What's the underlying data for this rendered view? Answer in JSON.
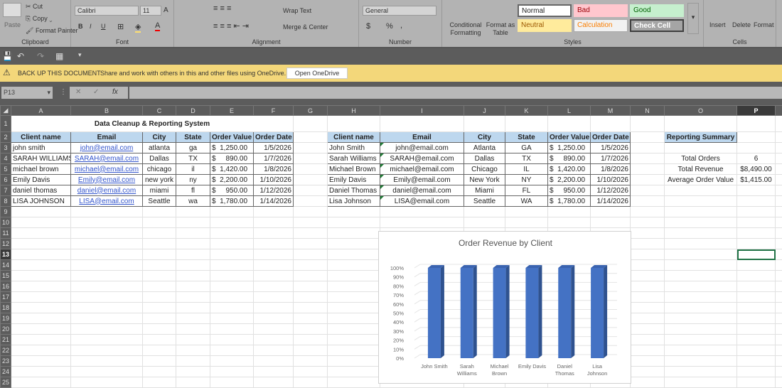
{
  "ribbon": {
    "clipboard": {
      "paste": "Paste",
      "cut": "Cut",
      "copy": "Copy",
      "format_painter": "Format Painter",
      "label": "Clipboard"
    },
    "font": {
      "name": "Calibri",
      "size": "11",
      "bold": "B",
      "italic": "I",
      "underline": "U",
      "label": "Font"
    },
    "alignment": {
      "wrap_text": "Wrap Text",
      "merge_center": "Merge & Center",
      "label": "Alignment"
    },
    "number": {
      "format": "General",
      "currency": "$",
      "percent": "%",
      "comma": ",",
      "label": "Number"
    },
    "styles": {
      "conditional_formatting": "Conditional Formatting",
      "format_as_table": "Format as Table",
      "normal": "Normal",
      "bad": "Bad",
      "good": "Good",
      "neutral": "Neutral",
      "calculation": "Calculation",
      "check_cell": "Check Cell",
      "label": "Styles"
    },
    "cells": {
      "insert": "Insert",
      "delete": "Delete",
      "format": "Format",
      "label": "Cells"
    }
  },
  "message_bar": {
    "title": "BACK UP THIS DOCUMENT",
    "text": "Share and work with others in this and other files using OneDrive.",
    "button": "Open OneDrive"
  },
  "formula_bar": {
    "name_box": "P13",
    "fx": "fx",
    "value": ""
  },
  "columns": [
    "A",
    "B",
    "C",
    "D",
    "E",
    "F",
    "G",
    "H",
    "I",
    "J",
    "K",
    "L",
    "M",
    "N",
    "O",
    "P",
    ""
  ],
  "selected_cell": "P13",
  "title": "Data Cleanup & Reporting System",
  "raw_table": {
    "headers": [
      "Client name",
      "Email",
      "City",
      "State",
      "Order Value",
      "Order Date"
    ],
    "rows": [
      [
        "john smith",
        "john@email.com",
        "atlanta",
        "ga",
        "$  1,250.00",
        "1/5/2026"
      ],
      [
        "SARAH WILLIAMS",
        "SARAH@email.com",
        "Dallas",
        "TX",
        "$     890.00",
        "1/7/2026"
      ],
      [
        "michael brown",
        "michael@email.com",
        "chicago",
        "il",
        "$  1,420.00",
        "1/8/2026"
      ],
      [
        "Emily Davis",
        "Emily@email.com",
        "new york",
        "ny",
        "$  2,200.00",
        "1/10/2026"
      ],
      [
        "daniel thomas",
        "daniel@email.com",
        "miami",
        "fl",
        "$     950.00",
        "1/12/2026"
      ],
      [
        "LISA JOHNSON",
        "LISA@email.com",
        "Seattle",
        "wa",
        "$  1,780.00",
        "1/14/2026"
      ]
    ]
  },
  "clean_table": {
    "headers": [
      "Client name",
      "Email",
      "City",
      "State",
      "Order Value",
      "Order Date"
    ],
    "rows": [
      [
        "John Smith",
        "john@email.com",
        "Atlanta",
        "GA",
        "$  1,250.00",
        "1/5/2026"
      ],
      [
        "Sarah Williams",
        "SARAH@email.com",
        "Dallas",
        "TX",
        "$     890.00",
        "1/7/2026"
      ],
      [
        "Michael Brown",
        "michael@email.com",
        "Chicago",
        "IL",
        "$  1,420.00",
        "1/8/2026"
      ],
      [
        "Emily Davis",
        "Emily@email.com",
        "New York",
        "NY",
        "$  2,200.00",
        "1/10/2026"
      ],
      [
        "Daniel Thomas",
        "daniel@email.com",
        "Miami",
        "FL",
        "$     950.00",
        "1/12/2026"
      ],
      [
        "Lisa Johnson",
        "LISA@email.com",
        "Seattle",
        "WA",
        "$  1,780.00",
        "1/14/2026"
      ]
    ]
  },
  "summary": {
    "header": "Reporting Summary",
    "items": [
      {
        "label": "Total Orders",
        "value": "6"
      },
      {
        "label": "Total Revenue",
        "value": "$8,490.00"
      },
      {
        "label": "Average Order Value",
        "value": "$1,415.00"
      }
    ]
  },
  "chart_data": {
    "type": "bar",
    "title": "Order Revenue by Client",
    "categories": [
      "John Smith",
      "Sarah Williams",
      "Michael Brown",
      "Emily Davis",
      "Daniel Thomas",
      "Lisa Johnson"
    ],
    "values": [
      100,
      100,
      100,
      100,
      100,
      100
    ],
    "yticks": [
      "0%",
      "10%",
      "20%",
      "30%",
      "40%",
      "50%",
      "60%",
      "70%",
      "80%",
      "90%",
      "100%"
    ],
    "ylim": [
      0,
      100
    ],
    "grid": true,
    "bar_color": "#4472c4"
  }
}
